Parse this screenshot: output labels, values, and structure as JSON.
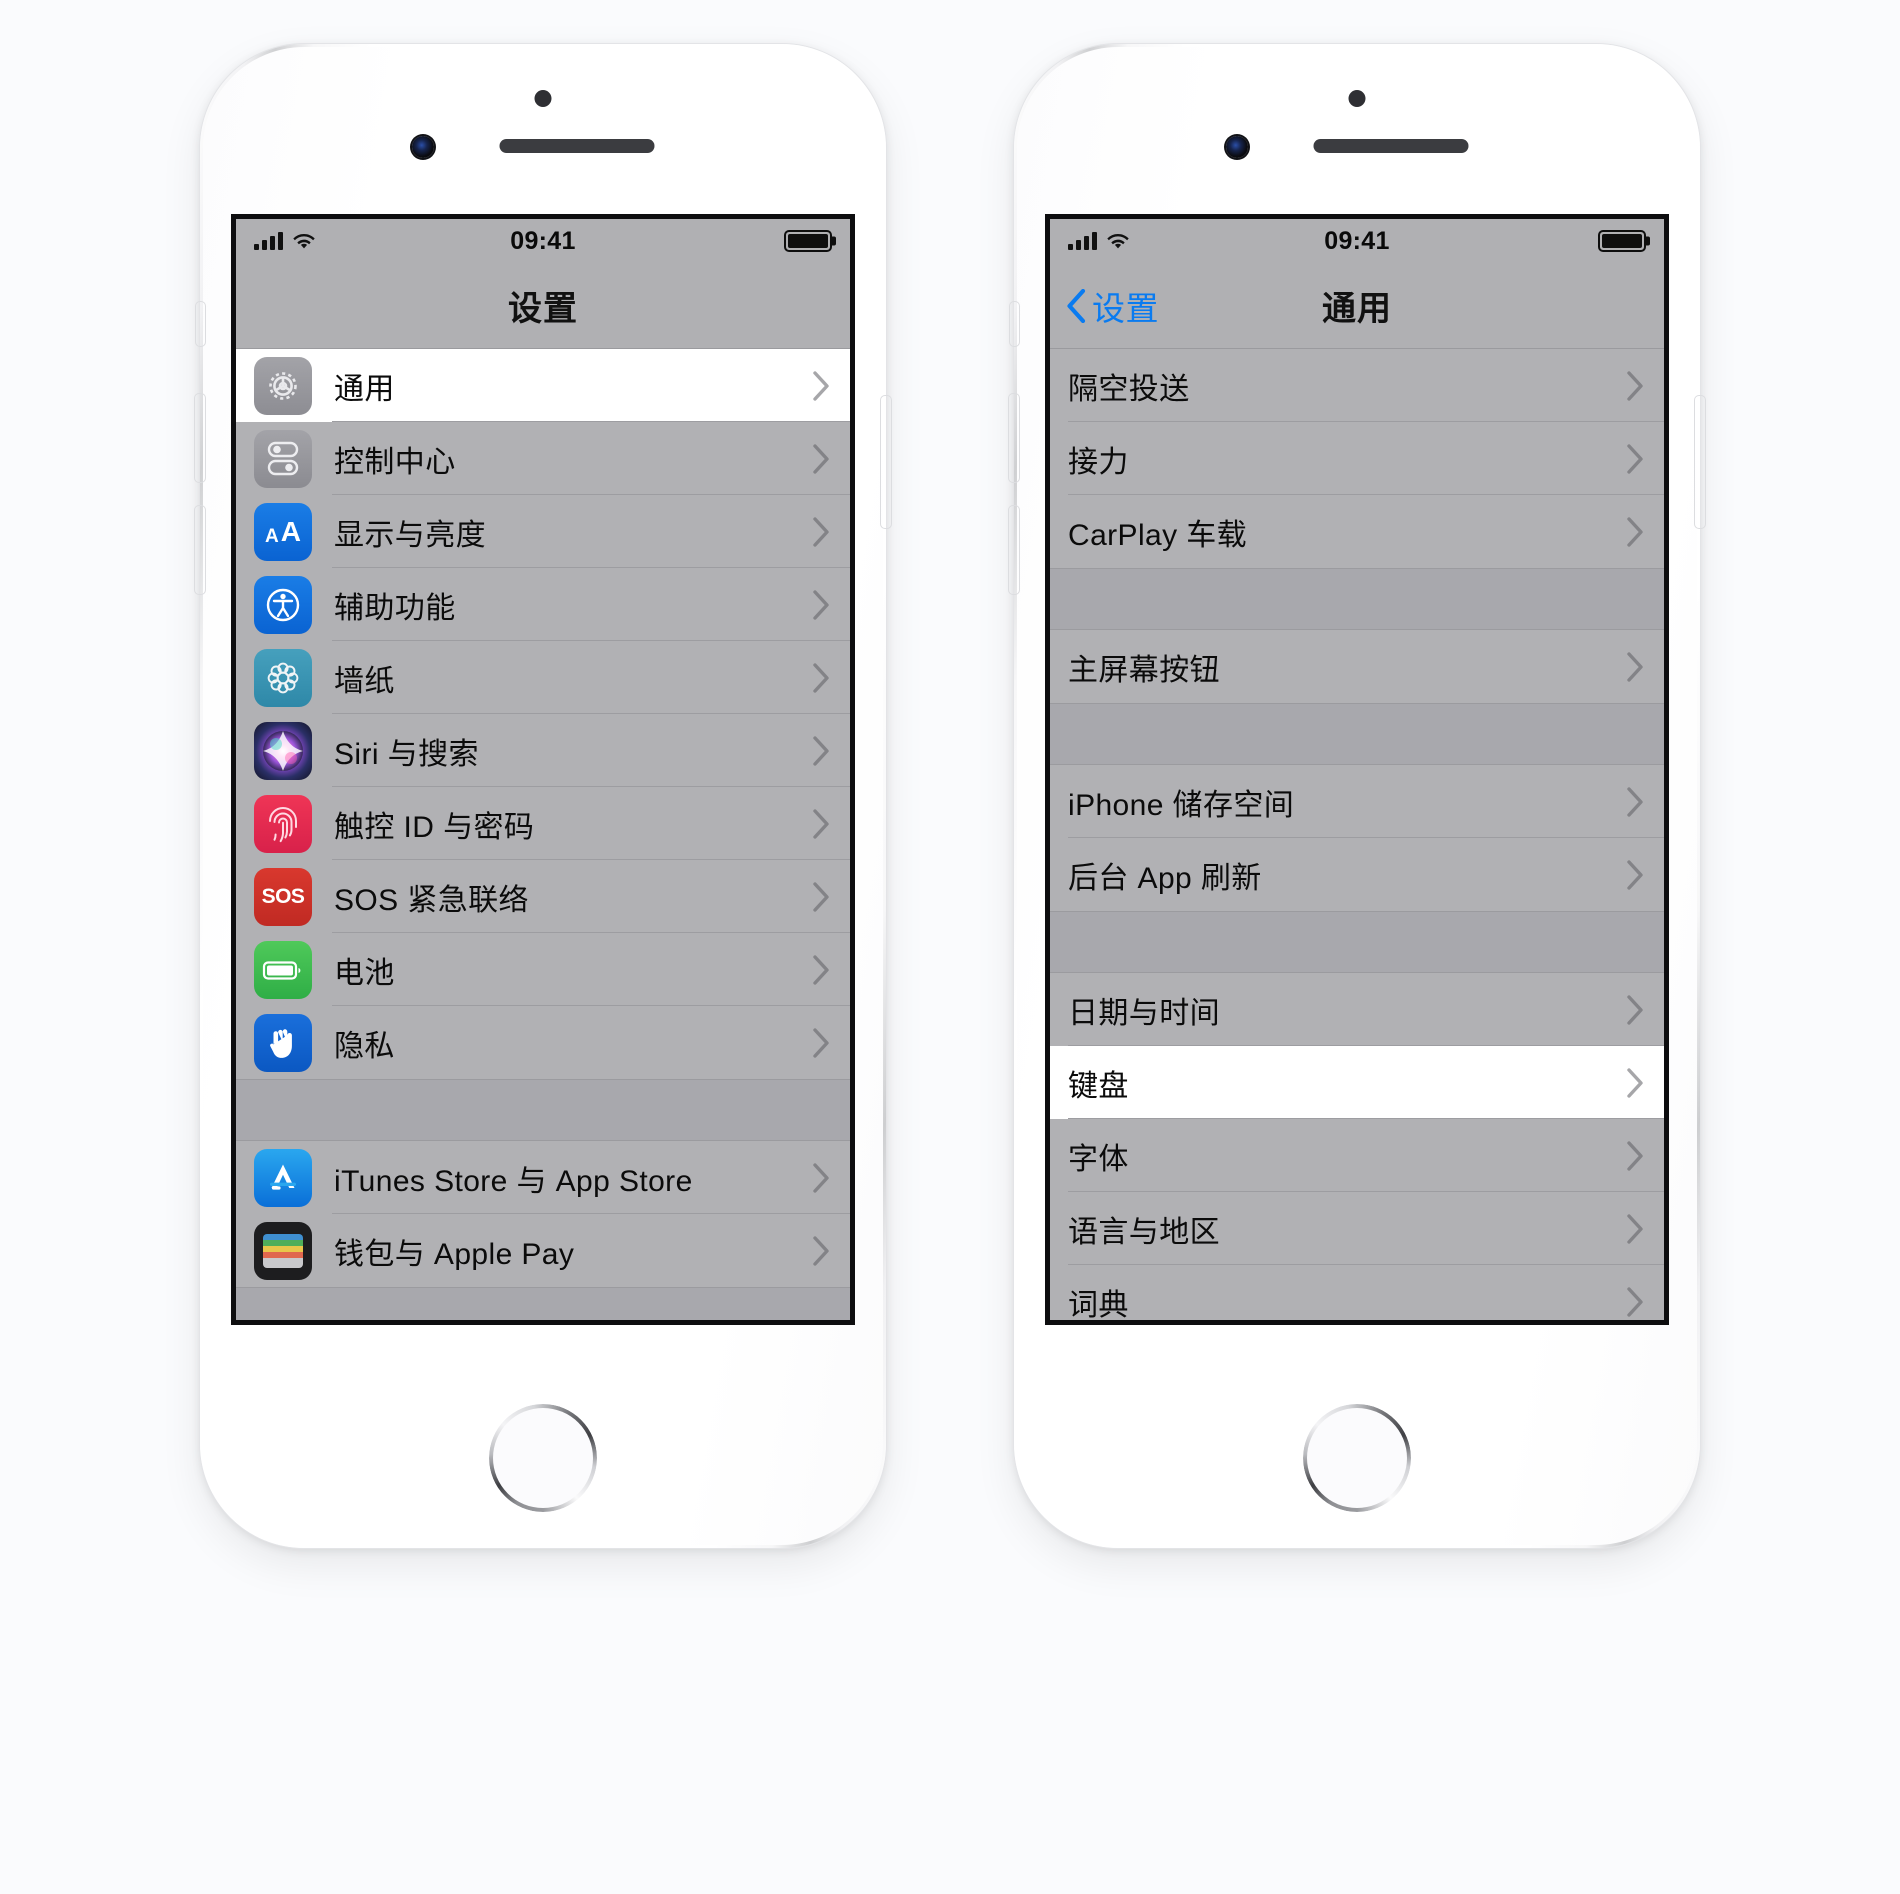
{
  "device": {
    "model_color": "silver",
    "icons": {
      "sensor": "proximity-sensor",
      "earpiece": "earpiece-speaker",
      "camera": "front-camera",
      "home": "home-button"
    }
  },
  "status_bar": {
    "signal_icon": "cellular-signal-icon",
    "wifi_icon": "wifi-icon",
    "time": "09:41",
    "battery_icon": "battery-full-icon"
  },
  "colors": {
    "tint": "#0a7bf0",
    "screen_bg": "#b1b1b4",
    "selected_row_bg": "#ffffff"
  },
  "phones": [
    {
      "id": "settings",
      "nav": {
        "title": "设置",
        "has_back": false,
        "back_label": ""
      },
      "groups": [
        {
          "rows": [
            {
              "label": "通用",
              "icon": "gear-icon",
              "icon_class": "ic-gear",
              "selected": true
            },
            {
              "label": "控制中心",
              "icon": "control-center-icon",
              "icon_class": "ic-cc",
              "selected": false
            },
            {
              "label": "显示与亮度",
              "icon": "display-icon",
              "icon_class": "ic-aa",
              "selected": false
            },
            {
              "label": "辅助功能",
              "icon": "accessibility-icon",
              "icon_class": "ic-access",
              "selected": false
            },
            {
              "label": "墙纸",
              "icon": "wallpaper-icon",
              "icon_class": "ic-wall",
              "selected": false
            },
            {
              "label": "Siri 与搜索",
              "icon": "siri-icon",
              "icon_class": "ic-siri",
              "selected": false
            },
            {
              "label": "触控 ID 与密码",
              "icon": "touch-id-icon",
              "icon_class": "ic-touch",
              "selected": false
            },
            {
              "label": "SOS 紧急联络",
              "icon": "sos-icon",
              "icon_class": "ic-sos",
              "selected": false
            },
            {
              "label": "电池",
              "icon": "battery-icon",
              "icon_class": "ic-batt",
              "selected": false
            },
            {
              "label": "隐私",
              "icon": "privacy-hand-icon",
              "icon_class": "ic-priv",
              "selected": false
            }
          ]
        },
        {
          "rows": [
            {
              "label": "iTunes Store 与 App Store",
              "icon": "app-store-icon",
              "icon_class": "ic-store",
              "selected": false
            },
            {
              "label": "钱包与 Apple Pay",
              "icon": "wallet-icon",
              "icon_class": "ic-wallet",
              "selected": false
            }
          ]
        }
      ]
    },
    {
      "id": "general",
      "nav": {
        "title": "通用",
        "has_back": true,
        "back_label": "设置"
      },
      "groups": [
        {
          "rows": [
            {
              "label": "隔空投送",
              "icon": null,
              "icon_class": null,
              "selected": false
            },
            {
              "label": "接力",
              "icon": null,
              "icon_class": null,
              "selected": false
            },
            {
              "label": "CarPlay 车载",
              "icon": null,
              "icon_class": null,
              "selected": false
            }
          ]
        },
        {
          "rows": [
            {
              "label": "主屏幕按钮",
              "icon": null,
              "icon_class": null,
              "selected": false
            }
          ]
        },
        {
          "rows": [
            {
              "label": "iPhone 储存空间",
              "icon": null,
              "icon_class": null,
              "selected": false
            },
            {
              "label": "后台 App 刷新",
              "icon": null,
              "icon_class": null,
              "selected": false
            }
          ]
        },
        {
          "rows": [
            {
              "label": "日期与时间",
              "icon": null,
              "icon_class": null,
              "selected": false
            },
            {
              "label": "键盘",
              "icon": null,
              "icon_class": null,
              "selected": true
            },
            {
              "label": "字体",
              "icon": null,
              "icon_class": null,
              "selected": false
            },
            {
              "label": "语言与地区",
              "icon": null,
              "icon_class": null,
              "selected": false
            },
            {
              "label": "词典",
              "icon": null,
              "icon_class": null,
              "selected": false
            }
          ]
        }
      ]
    }
  ]
}
